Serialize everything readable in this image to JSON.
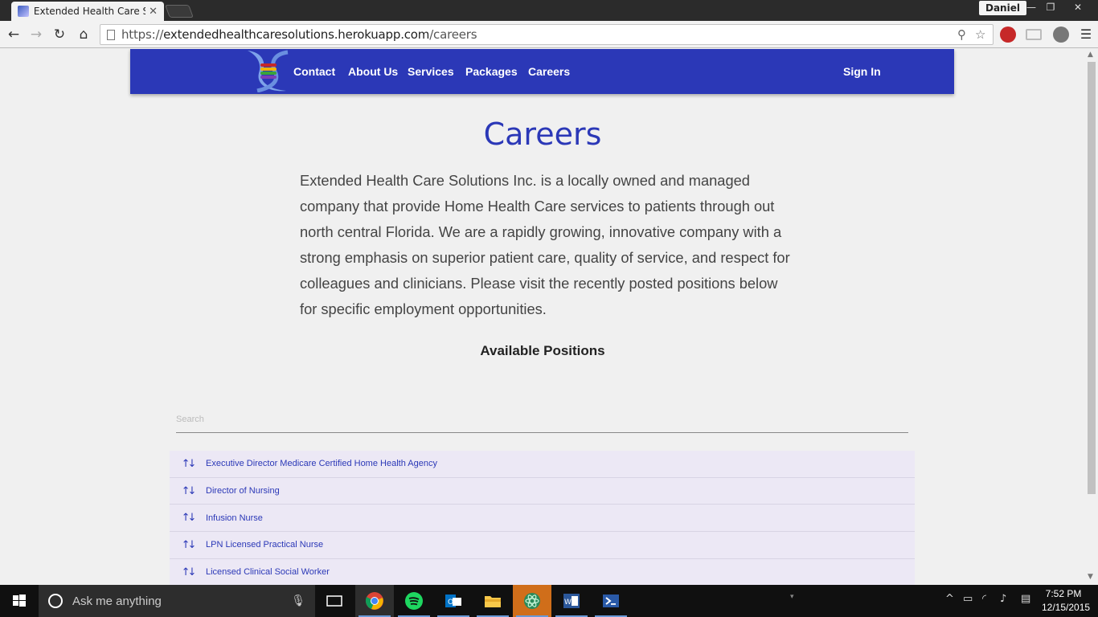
{
  "browser": {
    "tab_title": "Extended Health Care Solu",
    "user": "Daniel",
    "url_scheme": "https://",
    "url_host": "extendedhealthcaresolutions.herokuapp.com",
    "url_path": "/careers"
  },
  "site": {
    "nav": {
      "contact": "Contact",
      "about": "About Us",
      "services": "Services",
      "packages": "Packages",
      "careers": "Careers",
      "signin": "Sign In"
    },
    "title": "Careers",
    "intro": "Extended Health Care Solutions Inc. is a locally owned and managed company that provide Home Health Care services to patients through out north central Florida. We are a rapidly growing, innovative company with a strong emphasis on superior patient care, quality of service, and respect for colleagues and clinicians. Please visit the recently posted positions below for specific employment opportunities.",
    "positions_heading": "Available Positions",
    "search_placeholder": "Search",
    "positions": [
      "Executive Director Medicare Certified Home Health Agency",
      "Director of Nursing",
      "Infusion Nurse",
      "LPN Licensed Practical Nurse",
      "Licensed Clinical Social Worker"
    ],
    "brand_color": "#2b38b7"
  },
  "taskbar": {
    "search_text": "Ask me anything",
    "time": "7:52 PM",
    "date": "12/15/2015"
  }
}
